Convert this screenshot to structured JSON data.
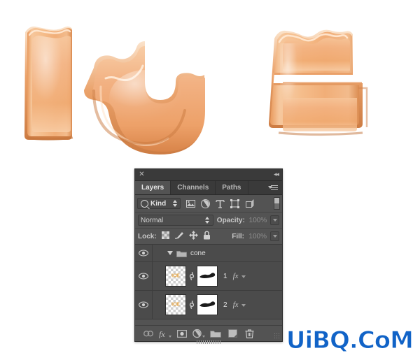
{
  "artwork": {
    "name": "ice-cone-lettering",
    "letters": [
      "I",
      "C",
      "E"
    ],
    "word": "ICE",
    "colors": {
      "cone_light": "#fbd9b5",
      "cone_mid": "#efab73",
      "cone_dark": "#d98a4e",
      "cone_shadow": "#c97a3f",
      "highlight": "#ffeede"
    }
  },
  "panel": {
    "titlebar": {
      "close_label": "✕",
      "collapse_label": "◂◂"
    },
    "tabs": [
      {
        "label": "Layers",
        "active": true
      },
      {
        "label": "Channels",
        "active": false
      },
      {
        "label": "Paths",
        "active": false
      }
    ],
    "filter": {
      "kind_label": "Kind",
      "icons": [
        "pixel-layer-filter-icon",
        "adjustment-layer-filter-icon",
        "type-layer-filter-icon",
        "shape-layer-filter-icon",
        "smart-object-filter-icon"
      ],
      "toggle_name": "filter-enable-toggle"
    },
    "blend": {
      "mode": "Normal",
      "opacity_label": "Opacity:",
      "opacity_value": "100%"
    },
    "lock": {
      "label": "Lock:",
      "icons": [
        "lock-transparent-pixels-icon",
        "lock-image-pixels-icon",
        "lock-position-icon",
        "lock-all-icon"
      ],
      "fill_label": "Fill:",
      "fill_value": "100%"
    },
    "layers": [
      {
        "type": "group",
        "name": "cone",
        "visible": true,
        "expanded": true
      },
      {
        "type": "layer",
        "name": "1",
        "visible": true,
        "thumb_text": "ICE",
        "has_mask": true,
        "has_fx": true,
        "linked": true
      },
      {
        "type": "layer",
        "name": "2",
        "visible": true,
        "thumb_text": "ICE",
        "has_mask": true,
        "has_fx": true,
        "linked": true
      }
    ],
    "bottom_tools": [
      "link-layers-icon",
      "layer-style-fx-icon",
      "add-layer-mask-icon",
      "new-adjustment-layer-icon",
      "new-group-icon",
      "new-layer-icon",
      "delete-layer-icon"
    ]
  },
  "watermark": {
    "text": "UiBQ.CoM",
    "color": "#1163c7"
  }
}
